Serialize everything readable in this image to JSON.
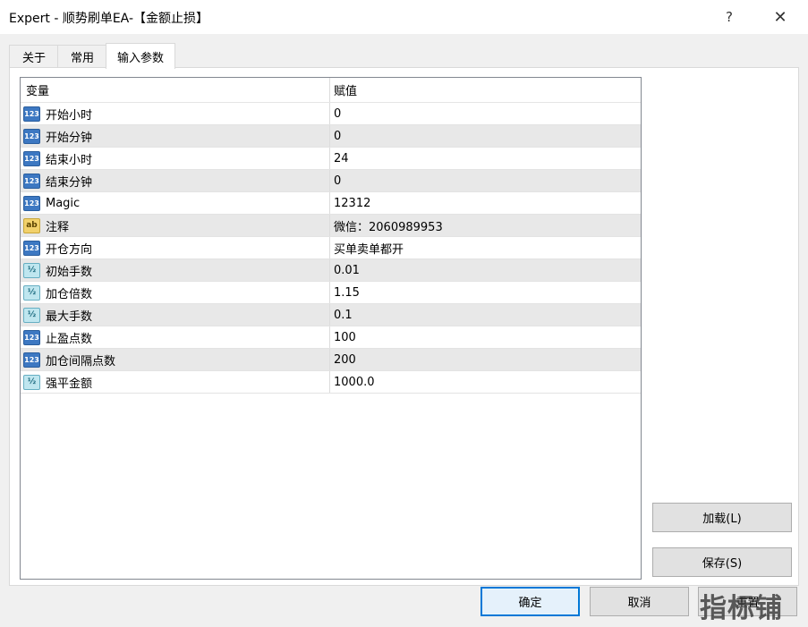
{
  "window": {
    "title": "Expert - 顺势刷单EA-【金额止损】",
    "help_glyph": "?",
    "close_glyph": "✕"
  },
  "tabs": [
    {
      "label": "关于"
    },
    {
      "label": "常用"
    },
    {
      "label": "输入参数"
    }
  ],
  "grid": {
    "headers": {
      "variable": "变量",
      "value": "赋值"
    },
    "rows": [
      {
        "type": "int",
        "name": "开始小时",
        "value": "0"
      },
      {
        "type": "int",
        "name": "开始分钟",
        "value": "0"
      },
      {
        "type": "int",
        "name": "结束小时",
        "value": "24"
      },
      {
        "type": "int",
        "name": "结束分钟",
        "value": "0"
      },
      {
        "type": "int",
        "name": "Magic",
        "value": "12312"
      },
      {
        "type": "string",
        "name": "注释",
        "value": "微信：2060989953"
      },
      {
        "type": "int",
        "name": "开仓方向",
        "value": "买单卖单都开"
      },
      {
        "type": "double",
        "name": "初始手数",
        "value": "0.01"
      },
      {
        "type": "double",
        "name": "加仓倍数",
        "value": "1.15"
      },
      {
        "type": "double",
        "name": "最大手数",
        "value": "0.1"
      },
      {
        "type": "int",
        "name": "止盈点数",
        "value": "100"
      },
      {
        "type": "int",
        "name": "加仓间隔点数",
        "value": "200"
      },
      {
        "type": "double",
        "name": "强平金额",
        "value": "1000.0"
      }
    ],
    "icon_text": {
      "int": "123",
      "string": "ab",
      "double": "½"
    }
  },
  "buttons": {
    "load": "加载(L)",
    "save": "保存(S)",
    "ok": "确定",
    "cancel": "取消",
    "reset": "重置"
  },
  "watermark": "指标铺",
  "colors": {
    "accent": "#0078d7",
    "alt_row": "#e8e8e8",
    "int_icon": "#3d78c2",
    "string_icon": "#f2d16b",
    "double_icon": "#bfe6ef"
  }
}
